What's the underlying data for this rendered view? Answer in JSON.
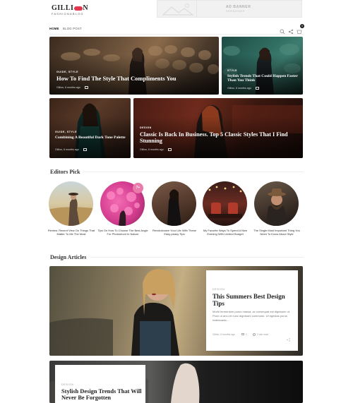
{
  "header": {
    "logo_text": "GILLI",
    "logo_tail": "N",
    "tagline": "FASHIONABLOG",
    "ad_title": "AD BANNER",
    "ad_subtitle": "SIDEBANNER"
  },
  "nav": {
    "items": [
      {
        "label": "HOME",
        "active": true
      },
      {
        "label": "BLOG POST",
        "active": false
      }
    ],
    "cart_count": "0"
  },
  "featured": [
    {
      "category": "GUIDE, STYLE",
      "title": "How To Find The Style That Compliments You",
      "meta": "Gillion, 6 months ago"
    },
    {
      "category": "STYLE",
      "title": "Stylish Trends That Could Happen Faster Than You Think",
      "meta": "Gillion, 6 months ago"
    },
    {
      "category": "GUIDE, STYLE",
      "title": "Combining A Beautiful Dark Tone Palette",
      "meta": "Gillion, 6 months ago"
    },
    {
      "category": "DESIGN",
      "title": "Classic Is Back In Business. Top 5 Classic Styles That I Find Stunning",
      "meta": "Gillion, 6 months ago"
    }
  ],
  "editors": {
    "heading": "Editors Pick",
    "items": [
      {
        "caption": "Review: Recent View On Things That Matter To Me The Most"
      },
      {
        "caption": "Tips On How To Choose The Best Angle For Photoshoot In Nature",
        "badge": "7+"
      },
      {
        "caption": "Revolutionize Your Life With These Easy-peasy Tips"
      },
      {
        "caption": "My Favorite Ways To Spend A Nice Evening With Limited Budget"
      },
      {
        "caption": "The Single Most Important Thing You Need To Know About Style"
      }
    ]
  },
  "design": {
    "heading": "Design Articles",
    "article1": {
      "category": "DESIGN",
      "title": "This Summers Best Design Tips",
      "excerpt": "Morbi fermentum purus massa, ac consequat est dignissim ut. Proin ut arcu et nunc dignissim commodo. Ut egestas purus malesuada...",
      "author": "Gillion, 6 months ago",
      "comments": "1",
      "read_time": "2 min read"
    },
    "article2": {
      "category": "DESIGN",
      "title": "Stylish Design Trends That Will Never Be Forgotten"
    }
  },
  "colors": {
    "accent": "#e0394f",
    "badge": "#e97aa9"
  }
}
